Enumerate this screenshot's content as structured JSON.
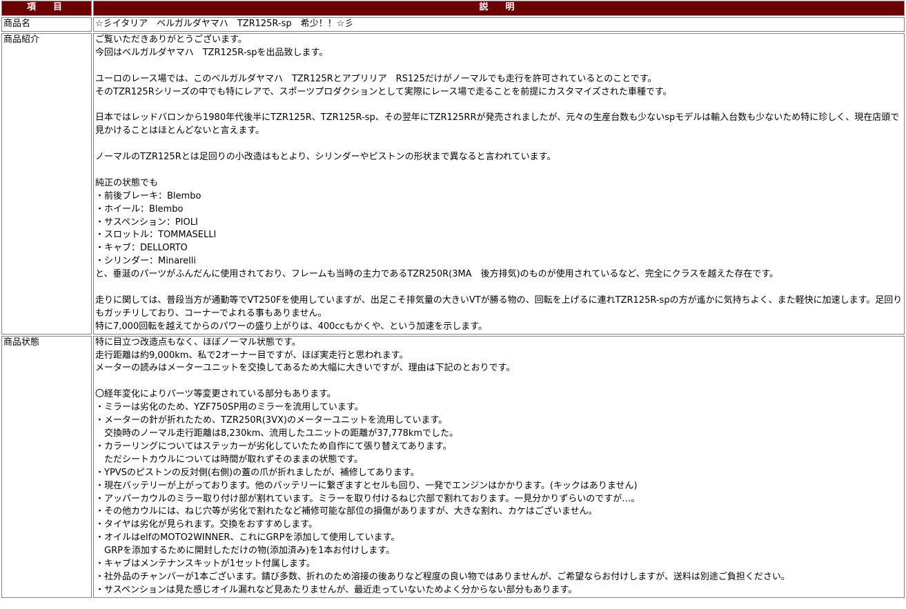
{
  "header": {
    "col_item": "項　目",
    "col_desc": "説　明"
  },
  "rows": {
    "name": {
      "label": "商品名",
      "value": "☆彡イタリア　ベルガルダヤマハ　TZR125R-sp　希少！！☆彡"
    },
    "intro": {
      "label": "商品紹介",
      "lines": [
        "ご覧いただきありがとうございます。",
        "今回はベルガルダヤマハ　TZR125R-spを出品致します。",
        "",
        "ユーロのレース場では、このベルガルダヤマハ　TZR125Rとアプリリア　RS125だけがノーマルでも走行を許可されているとのことです。",
        "そのTZR125Rシリーズの中でも特にレアで、スポーツプロダクションとして実際にレース場で走ることを前提にカスタマイズされた車種です。",
        "",
        "日本ではレッドバロンから1980年代後半にTZR125R、TZR125R-sp、その翌年にTZR125RRが発売されましたが、元々の生産台数も少ないspモデルは輸入台数も少ないため特に珍しく、現在店頭で見かけることはほとんどないと言えます。",
        "",
        "ノーマルのTZR125Rとは足回りの小改造はもとより、シリンダーやピストンの形状まで異なると言われています。",
        "",
        "純正の状態でも",
        "・前後ブレーキ：Blembo",
        "・ホイール：Blembo",
        "・サスペンション：PIOLI",
        "・スロットル：TOMMASELLI",
        "・キャブ：DELLORTO",
        "・シリンダー：Minarelli",
        "と、垂涎のパーツがふんだんに使用されており、フレームも当時の主力であるTZR250R(3MA　後方排気)のものが使用されているなど、完全にクラスを越えた存在です。",
        "",
        "走りに関しては、普段当方が通勤等でVT250Fを使用していますが、出足こそ排気量の大きいVTが勝る物の、回転を上げるに連れTZR125R-spの方が遙かに気持ちよく、また軽快に加速します。足回りもガッチリしており、コーナーでよれる事もありません。",
        "特に7,000回転を越えてからのパワーの盛り上がりは、400ccもかくや、という加速を示します。"
      ]
    },
    "condition": {
      "label": "商品状態",
      "lines": [
        "特に目立つ改造点もなく、ほぼノーマル状態です。",
        "走行距離は約9,000km、私で2オーナー目ですが、ほぼ実走行と思われます。",
        "メーターの読みはメーターユニットを交換してあるため大幅に大きいですが、理由は下記のとおりです。",
        "",
        "〇経年変化によりパーツ等変更されている部分もあります。",
        "・ミラーは劣化のため、YZF750SP用のミラーを流用しています。",
        "・メーターの針が折れたため、TZR250R(3VX)のメーターユニットを流用しています。",
        "　交換時のノーマル走行距離は8,230km、流用したユニットの距離が37,778kmでした。",
        "・カラーリングについてはステッカーが劣化していたため自作にて張り替えてあります。",
        "　ただシートカウルについては時間が取れずそのままの状態です。",
        "・YPVSのピストンの反対側(右側)の蓋の爪が折れましたが、補修してあります。",
        "・現在バッテリーが上がっております。他のバッテリーに繋ぎますとセルも回り、一発でエンジンはかかります。(キックはありません)",
        "・アッパーカウルのミラー取り付け部が割れています。ミラーを取り付けるねじ穴部で割れております。一見分かりずらいのですが…。",
        "・その他カウルには、ねじ穴等が劣化で割れたなど補修可能な部位の損傷がありますが、大きな割れ、カケはございません。",
        "・タイヤは劣化が見られます。交換をおすすめします。",
        "・オイルはelfのMOTO2WINNER、これにGRPを添加して使用しています。",
        "　GRPを添加するために開封しただけの物(添加済み)を1本お付けします。",
        "・キャブはメンテナンスキットが1セット付属します。",
        "・社外品のチャンバーが1本ございます。錆び多数、折れのため溶接の後ありなど程度の良い物ではありませんが、ご希望ならお付けしますが、送料は別途ご負担ください。",
        "・サスペンションは見た感じオイル漏れなど見あたりませんが、最近走っていないためよく分からない部分もあります。"
      ]
    }
  },
  "colors": {
    "header_bg": "#6b0000",
    "header_text": "#ffffff",
    "border": "#808080"
  }
}
